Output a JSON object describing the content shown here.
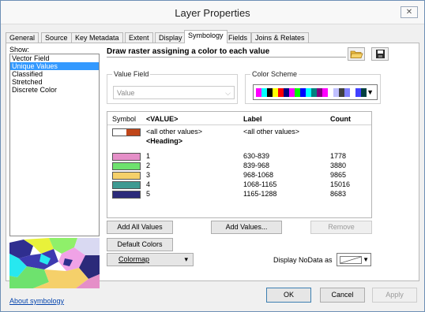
{
  "window": {
    "title": "Layer Properties",
    "close_icon": "close-icon"
  },
  "tabs": [
    {
      "label": "General"
    },
    {
      "label": "Source"
    },
    {
      "label": "Key Metadata"
    },
    {
      "label": "Extent"
    },
    {
      "label": "Display"
    },
    {
      "label": "Symbology",
      "active": true
    },
    {
      "label": "Fields"
    },
    {
      "label": "Joins & Relates"
    }
  ],
  "show": {
    "label": "Show:",
    "items": [
      "Vector Field",
      "Unique Values",
      "Classified",
      "Stretched",
      "Discrete Color"
    ],
    "selected": "Unique Values"
  },
  "about_link": "About symbology",
  "heading": "Draw raster assigning a color to each value",
  "value_field": {
    "label": "Value Field",
    "value": "Value"
  },
  "color_scheme": {
    "label": "Color Scheme",
    "swatches": [
      "#ff00ff",
      "#00ffff",
      "#000000",
      "#ffff00",
      "#ff0000",
      "#000080",
      "#ff00ff",
      "#00ff00",
      "#0000ff",
      "#00ffff",
      "#008080",
      "#800080",
      "#ff00ff",
      "#ffffff",
      "#c0c0ff",
      "#404040",
      "#8080ff",
      "#ffffff",
      "#4040ff",
      "#004040"
    ]
  },
  "table": {
    "headers": {
      "symbol": "Symbol",
      "value": "<VALUE>",
      "label": "Label",
      "count": "Count"
    },
    "other_row": {
      "value": "<all other values>",
      "label": "<all other values>",
      "colors": [
        "#ffffff",
        "#c0461a"
      ]
    },
    "group_heading": "<Heading>",
    "rows": [
      {
        "value": "1",
        "label": "630-839",
        "count": "1778",
        "color": "#e58fc8"
      },
      {
        "value": "2",
        "label": "839-968",
        "count": "3880",
        "color": "#6ee26e"
      },
      {
        "value": "3",
        "label": "968-1068",
        "count": "9865",
        "color": "#f5d06a"
      },
      {
        "value": "4",
        "label": "1068-1165",
        "count": "15016",
        "color": "#3e9a92"
      },
      {
        "value": "5",
        "label": "1165-1288",
        "count": "8683",
        "color": "#2b2a7a"
      }
    ]
  },
  "buttons": {
    "add_all": "Add All Values",
    "add_values": "Add Values...",
    "remove": "Remove",
    "default_colors": "Default Colors",
    "colormap": "Colormap"
  },
  "nodata_label": "Display NoData as",
  "footer": {
    "ok": "OK",
    "cancel": "Cancel",
    "apply": "Apply"
  }
}
